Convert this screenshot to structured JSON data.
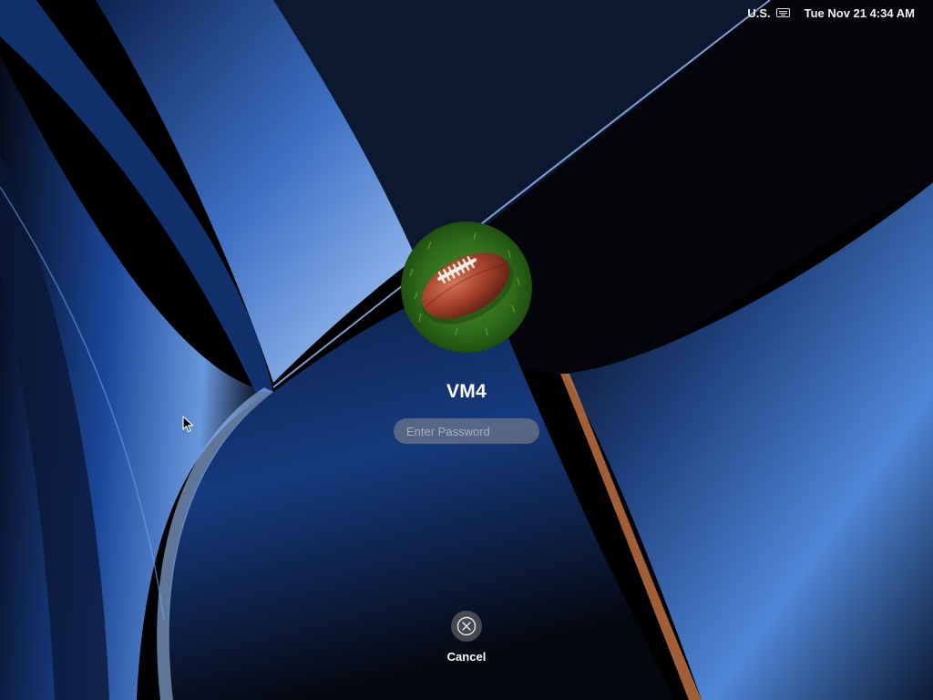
{
  "status_bar": {
    "input_source": "U.S.",
    "input_source_icon": "keyboard-icon",
    "clock": "Tue Nov 21  4:34 AM"
  },
  "login": {
    "avatar_icon": "football-avatar",
    "username": "VM4",
    "password_placeholder": "Enter Password",
    "password_value": "",
    "cancel_label": "Cancel",
    "cancel_icon": "close-circle-icon"
  },
  "colors": {
    "background": "#000000",
    "wallpaper_blue": "#2f6fd6",
    "wallpaper_highlight": "#9fc4ff",
    "text": "#ffffff"
  }
}
